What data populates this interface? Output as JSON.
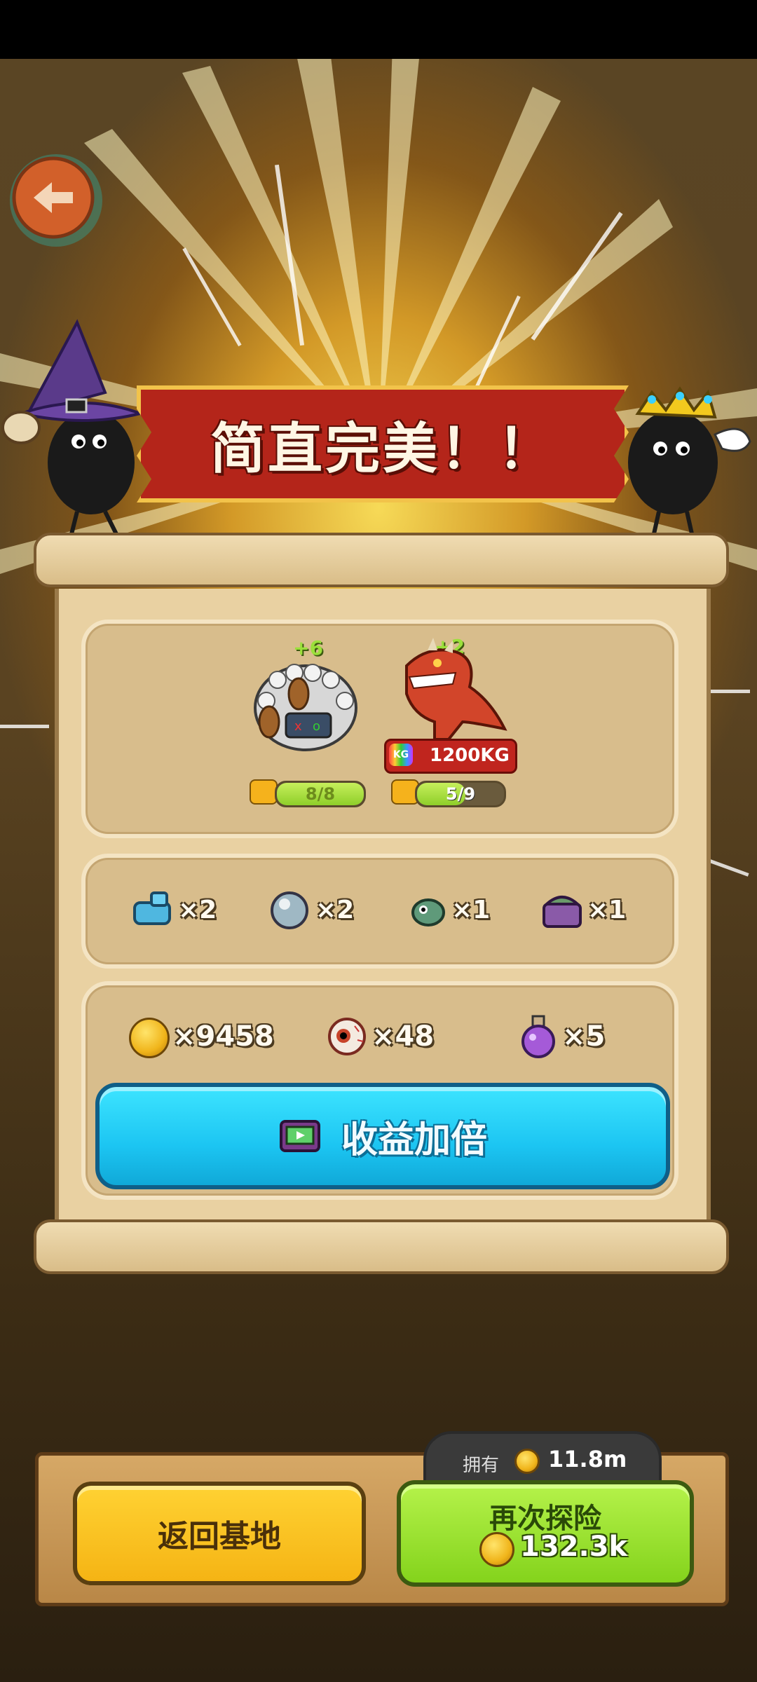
{
  "banner": {
    "title": "简直完美！！"
  },
  "monsters": [
    {
      "name": "wool-sheep-monster",
      "bonus": "+6",
      "level_text": "8/8",
      "level_fraction": 1.0
    },
    {
      "name": "red-dino-monster",
      "bonus": "+2",
      "weight": "1200KG",
      "weight_tag": "KG",
      "level_text": "5/9",
      "level_fraction": 0.556
    }
  ],
  "items": [
    {
      "icon": "blue-machine-icon",
      "count": "×2"
    },
    {
      "icon": "pearl-orb-icon",
      "count": "×2"
    },
    {
      "icon": "green-creature-icon",
      "count": "×1"
    },
    {
      "icon": "purple-chest-icon",
      "count": "×1"
    }
  ],
  "resources": [
    {
      "icon": "gold-coin-icon",
      "count": "×9458"
    },
    {
      "icon": "eyeball-icon",
      "count": "×48"
    },
    {
      "icon": "purple-potion-icon",
      "count": "×5"
    }
  ],
  "double_button": {
    "label": "收益加倍",
    "icon": "tv-ad-icon"
  },
  "owned": {
    "label": "拥有",
    "value": "11.8m"
  },
  "buttons": {
    "return_home": "返回基地",
    "explore_again": "再次探险",
    "explore_cost": "132.3k"
  },
  "colors": {
    "banner_red": "#b4251a",
    "cyan_button": "#1cc5f2",
    "green_button": "#84d31c",
    "yellow_button": "#f5b414"
  }
}
